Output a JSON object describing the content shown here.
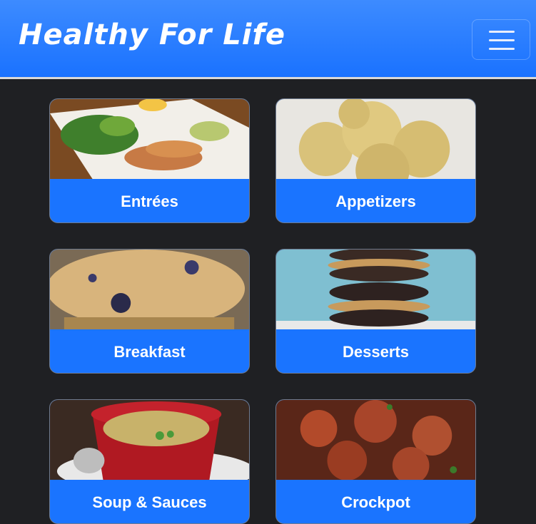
{
  "header": {
    "brand": "Healthy For Life",
    "menu_icon": "hamburger-menu-icon"
  },
  "categories": [
    {
      "label": "Entrées",
      "image": "grilled-fish-salad-photo"
    },
    {
      "label": "Appetizers",
      "image": "cheese-biscuits-photo"
    },
    {
      "label": "Breakfast",
      "image": "blueberry-muffin-photo"
    },
    {
      "label": "Desserts",
      "image": "chocolate-sandwich-cookies-photo"
    },
    {
      "label": "Soup & Sauces",
      "image": "creamy-soup-cup-photo"
    },
    {
      "label": "Crockpot",
      "image": "crockpot-chili-photo"
    }
  ],
  "colors": {
    "primary": "#1a74ff",
    "background": "#1f2023"
  }
}
